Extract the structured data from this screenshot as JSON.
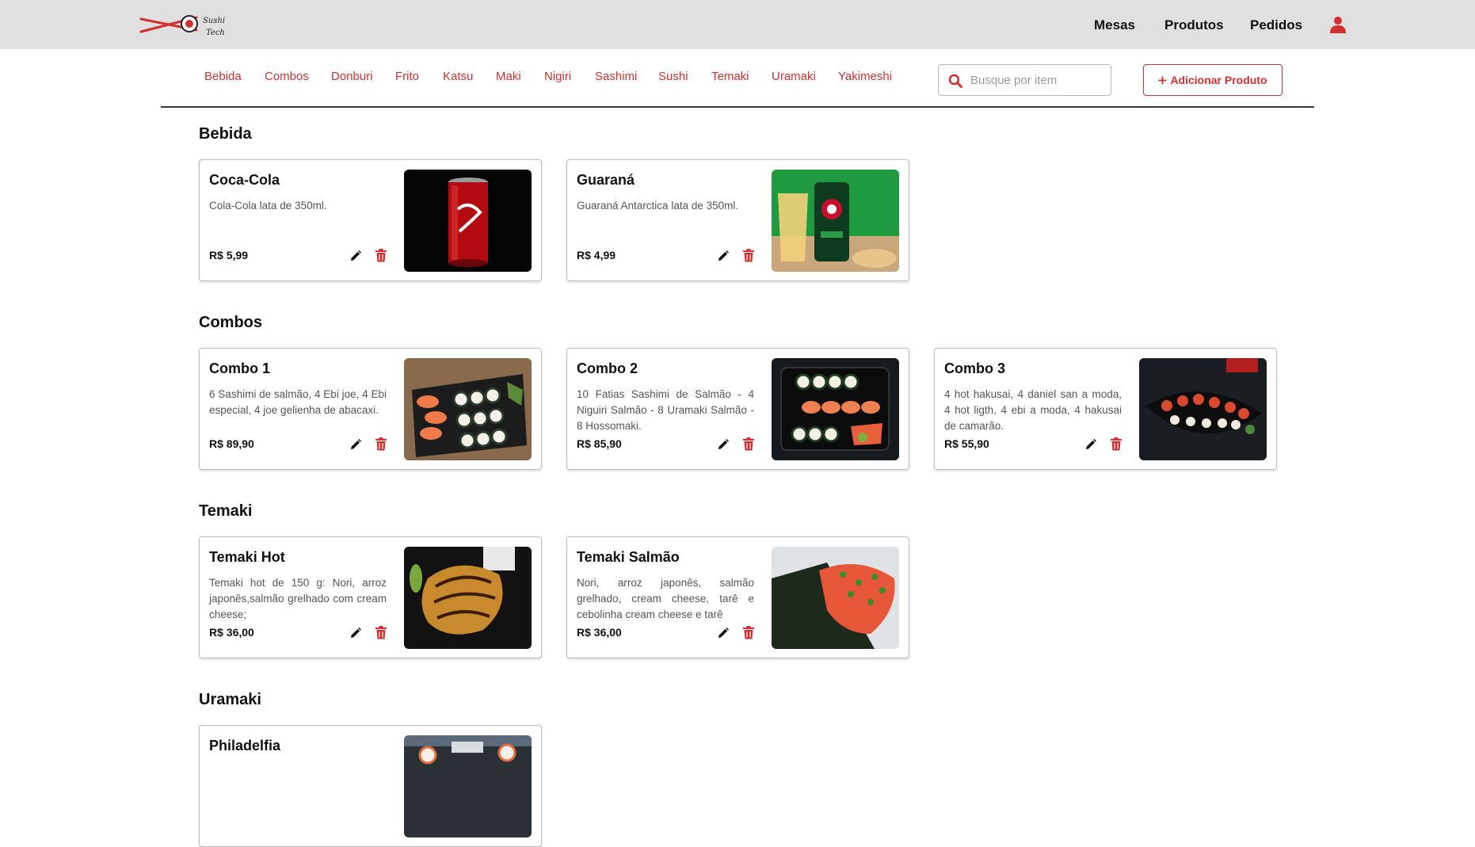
{
  "header": {
    "logo_text_1": "Sushi",
    "logo_text_2": "Tech",
    "nav": [
      "Mesas",
      "Produtos",
      "Pedidos"
    ]
  },
  "categories": [
    "Bebida",
    "Combos",
    "Donburi",
    "Frito",
    "Katsu",
    "Maki",
    "Nigiri",
    "Sashimi",
    "Sushi",
    "Temaki",
    "Uramaki",
    "Yakimeshi"
  ],
  "search": {
    "placeholder": "Busque por item",
    "value": ""
  },
  "add_button": {
    "label": "Adicionar Produto"
  },
  "sections": [
    {
      "title": "Bebida",
      "products": [
        {
          "name": "Coca-Cola",
          "description": "Cola-Cola lata de 350ml.",
          "price": "R$ 5,99",
          "image": "coca-cola-can"
        },
        {
          "name": "Guaraná",
          "description": "Guaraná Antarctica lata de 350ml.",
          "price": "R$ 4,99",
          "image": "guarana-can"
        }
      ]
    },
    {
      "title": "Combos",
      "products": [
        {
          "name": "Combo 1",
          "description": "6 Sashimi de salmão, 4 Ebi joe, 4 Ebi especial, 4 joe gelienha de abacaxi.",
          "price": "R$ 89,90",
          "image": "sushi-combo-board"
        },
        {
          "name": "Combo 2",
          "description": "10 Fatias Sashimi de Salmão - 4 Niguiri Salmão - 8 Uramaki Salmão - 8 Hossomaki.",
          "price": "R$ 85,90",
          "image": "sushi-combo-tray"
        },
        {
          "name": "Combo 3",
          "description": "4 hot hakusai, 4 daniel san a moda, 4 hot ligth, 4 ebi a moda, 4 hakusai de camarão.",
          "price": "R$ 55,90",
          "image": "sushi-combo-boat"
        }
      ]
    },
    {
      "title": "Temaki",
      "products": [
        {
          "name": "Temaki Hot",
          "description": "Temaki hot de 150 g: Nori, arroz japonês,salmão grelhado com cream cheese;",
          "price": "R$ 36,00",
          "image": "temaki-hot"
        },
        {
          "name": "Temaki Salmão",
          "description": "Nori, arroz japonês, salmão grelhado, cream cheese, tarê e cebolinha cream cheese e tarê",
          "price": "R$ 36,00",
          "image": "temaki-salmon"
        }
      ]
    },
    {
      "title": "Uramaki",
      "products": [
        {
          "name": "Philadelfia",
          "description": "",
          "price": "",
          "image": "uramaki-philadelfia"
        }
      ]
    }
  ],
  "colors": {
    "accent": "#d32f2f",
    "header_bg": "#e0e0e0"
  },
  "icons": {
    "user": "user-icon",
    "search": "search-icon",
    "edit": "pencil-icon",
    "delete": "trash-icon",
    "add": "plus-icon"
  }
}
